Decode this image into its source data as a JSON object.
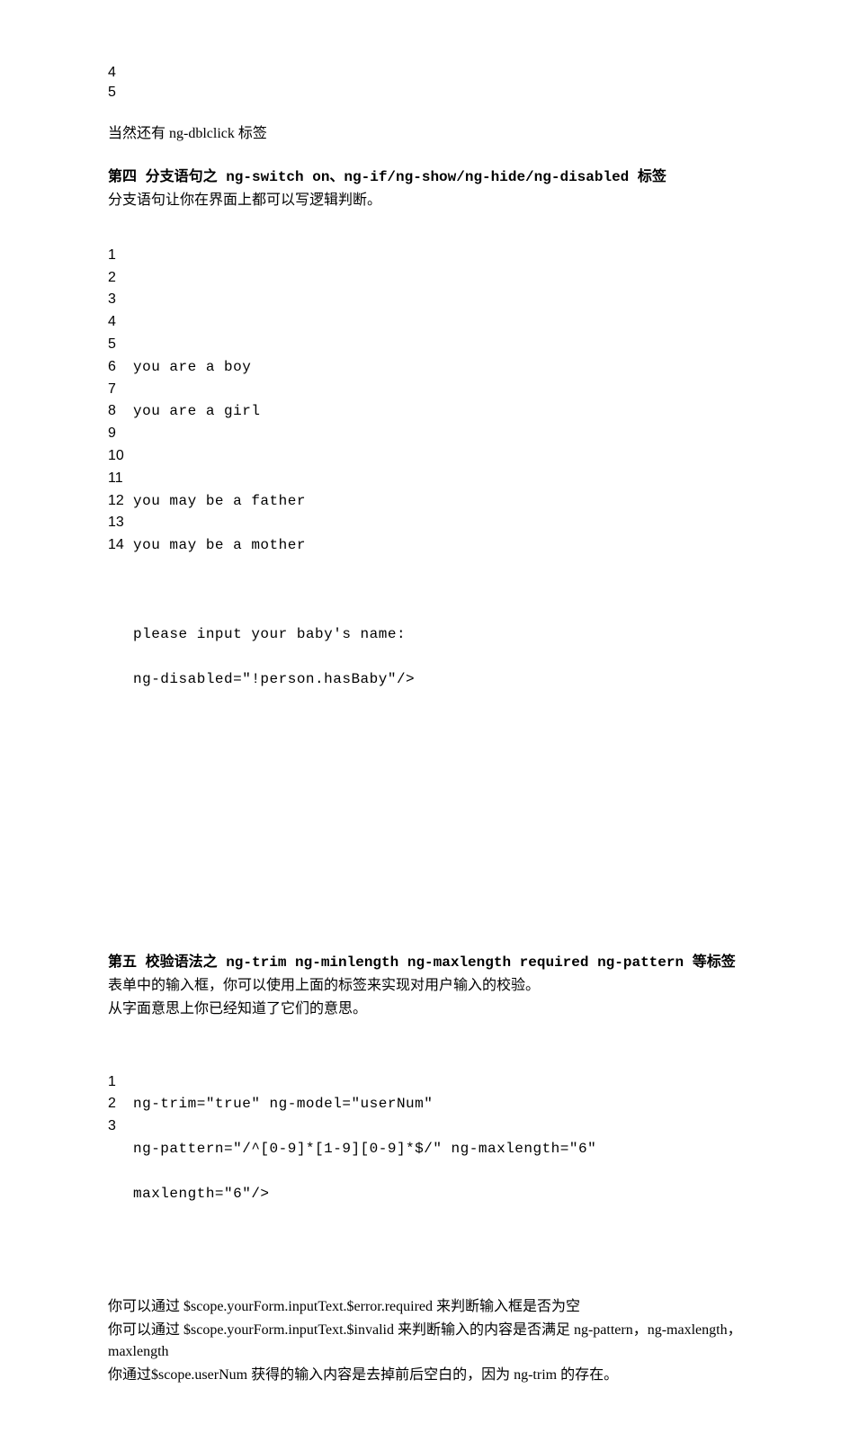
{
  "top_numbers": [
    "4",
    "5"
  ],
  "intro_line": "当然还有 ng-dblclick 标签",
  "section4": {
    "title": "第四 分支语句之 ng-switch on、ng-if/ng-show/ng-hide/ng-disabled 标签",
    "subtitle": "分支语句让你在界面上都可以写逻辑判断。",
    "line_numbers": [
      "1",
      "2",
      "3",
      "4",
      "5",
      "6",
      "7",
      "8",
      "9",
      "10",
      "11",
      "12",
      "13",
      "14"
    ],
    "code_lines": [
      "",
      "",
      "you are a boy",
      "you are a girl",
      "",
      "you may be a father",
      "you may be a mother",
      "",
      "please input your baby's name:",
      "ng-disabled=\"!person.hasBaby\"/>",
      "",
      "",
      "",
      ""
    ]
  },
  "section5": {
    "title": "第五 校验语法之 ng-trim ng-minlength ng-maxlength required ng-pattern 等标签",
    "subtitle1": "表单中的输入框，你可以使用上面的标签来实现对用户输入的校验。",
    "subtitle2": "从字面意思上你已经知道了它们的意思。",
    "line_numbers": [
      "1",
      "2",
      "3"
    ],
    "code_lines": [
      "ng-trim=\"true\" ng-model=\"userNum\"",
      "ng-pattern=\"/^[0-9]*[1-9][0-9]*$/\" ng-maxlength=\"6\"",
      "maxlength=\"6\"/>"
    ],
    "footer1": "你可以通过 $scope.yourForm.inputText.$error.required 来判断输入框是否为空",
    "footer2": "你可以通过 $scope.yourForm.inputText.$invalid 来判断输入的内容是否满足 ng-pattern，ng-maxlength，maxlength",
    "footer3": "你通过$scope.userNum 获得的输入内容是去掉前后空白的，因为 ng-trim 的存在。"
  }
}
